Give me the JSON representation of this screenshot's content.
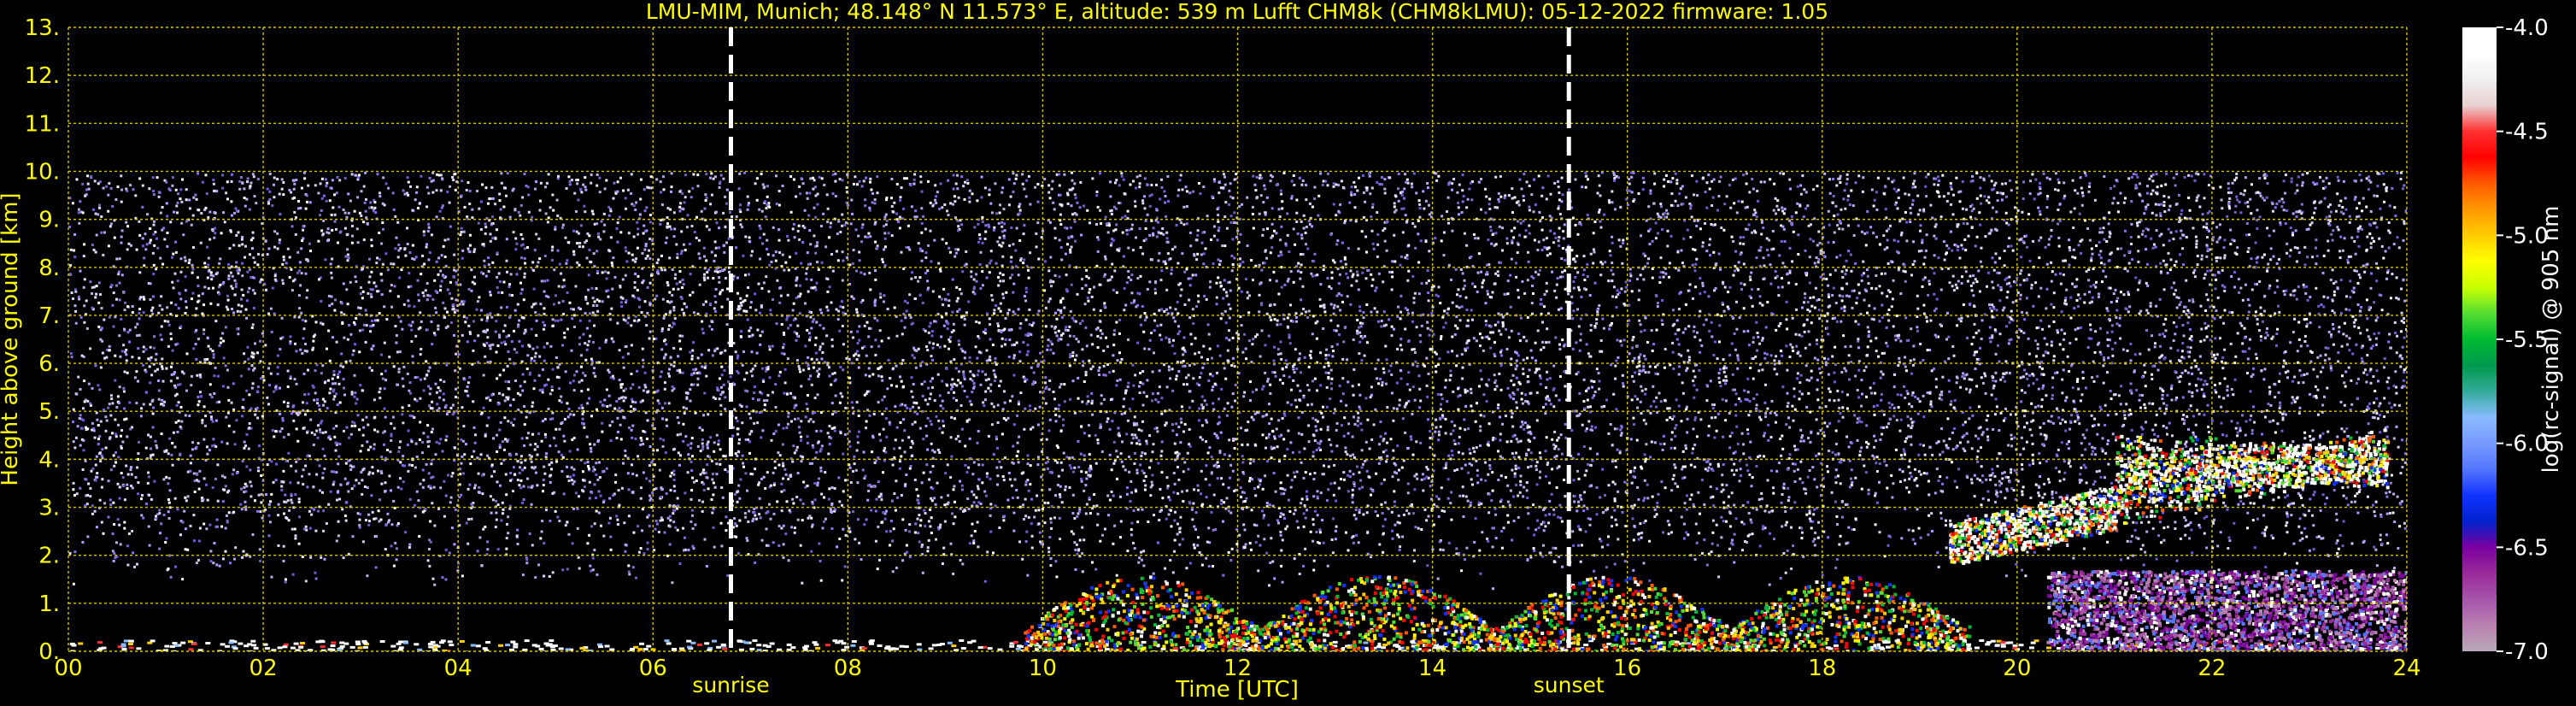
{
  "chart_data": {
    "type": "heatmap",
    "title": "LMU-MIM, Munich; 48.148° N 11.573° E, altitude: 539 m    Lufft CHM8k (CHM8kLMU): 05-12-2022    firmware: 1.05",
    "xlabel": "Time [UTC]",
    "ylabel": "Height above ground [km]",
    "xlim": [
      0,
      24
    ],
    "ylim": [
      0,
      13
    ],
    "x_ticks": [
      "00",
      "02",
      "04",
      "06",
      "08",
      "10",
      "12",
      "14",
      "16",
      "18",
      "20",
      "22",
      "24"
    ],
    "y_ticks": [
      "0.",
      "1.",
      "2.",
      "3.",
      "4.",
      "5.",
      "6.",
      "7.",
      "8.",
      "9.",
      "10.",
      "11.",
      "12.",
      "13."
    ],
    "grid": true,
    "markers": [
      {
        "label": "sunrise",
        "x": 6.8
      },
      {
        "label": "sunset",
        "x": 15.4
      }
    ],
    "colorbar": {
      "label": "log(rc-signal) @ 905 nm",
      "range": [
        -7.0,
        -4.0
      ],
      "ticks": [
        "-4.0",
        "-4.5",
        "-5.0",
        "-5.5",
        "-6.0",
        "-6.5",
        "-7.0"
      ],
      "colors": [
        "#ffffff",
        "#ffffff",
        "#f0f0f0",
        "#e8d0d0",
        "#ff3030",
        "#ff0000",
        "#ff5a00",
        "#ff9900",
        "#ffcc00",
        "#ffff00",
        "#c8ff00",
        "#55dd33",
        "#00bb33",
        "#00994d",
        "#33aa99",
        "#88bbff",
        "#7799ff",
        "#5577ff",
        "#1133ff",
        "#0022cc",
        "#7a00a0",
        "#9a2a99",
        "#a555aa",
        "#b880b0",
        "#b8a8b8"
      ]
    },
    "features": [
      {
        "name": "surface layer",
        "x_range": [
          0,
          24
        ],
        "height_km": [
          0,
          0.3
        ]
      },
      {
        "name": "noise region",
        "x_range": [
          0,
          24
        ],
        "height_km": [
          2,
          10
        ]
      },
      {
        "name": "daytime aerosol layer",
        "x_range": [
          9.8,
          19.5
        ],
        "height_km": [
          0,
          1.6
        ]
      },
      {
        "name": "elevated cloud",
        "x_range": [
          19.3,
          23.8
        ],
        "height_km": [
          1.8,
          5.8
        ]
      },
      {
        "name": "low dense layer",
        "x_range": [
          20.3,
          24
        ],
        "height_km": [
          0,
          1.7
        ]
      }
    ]
  }
}
